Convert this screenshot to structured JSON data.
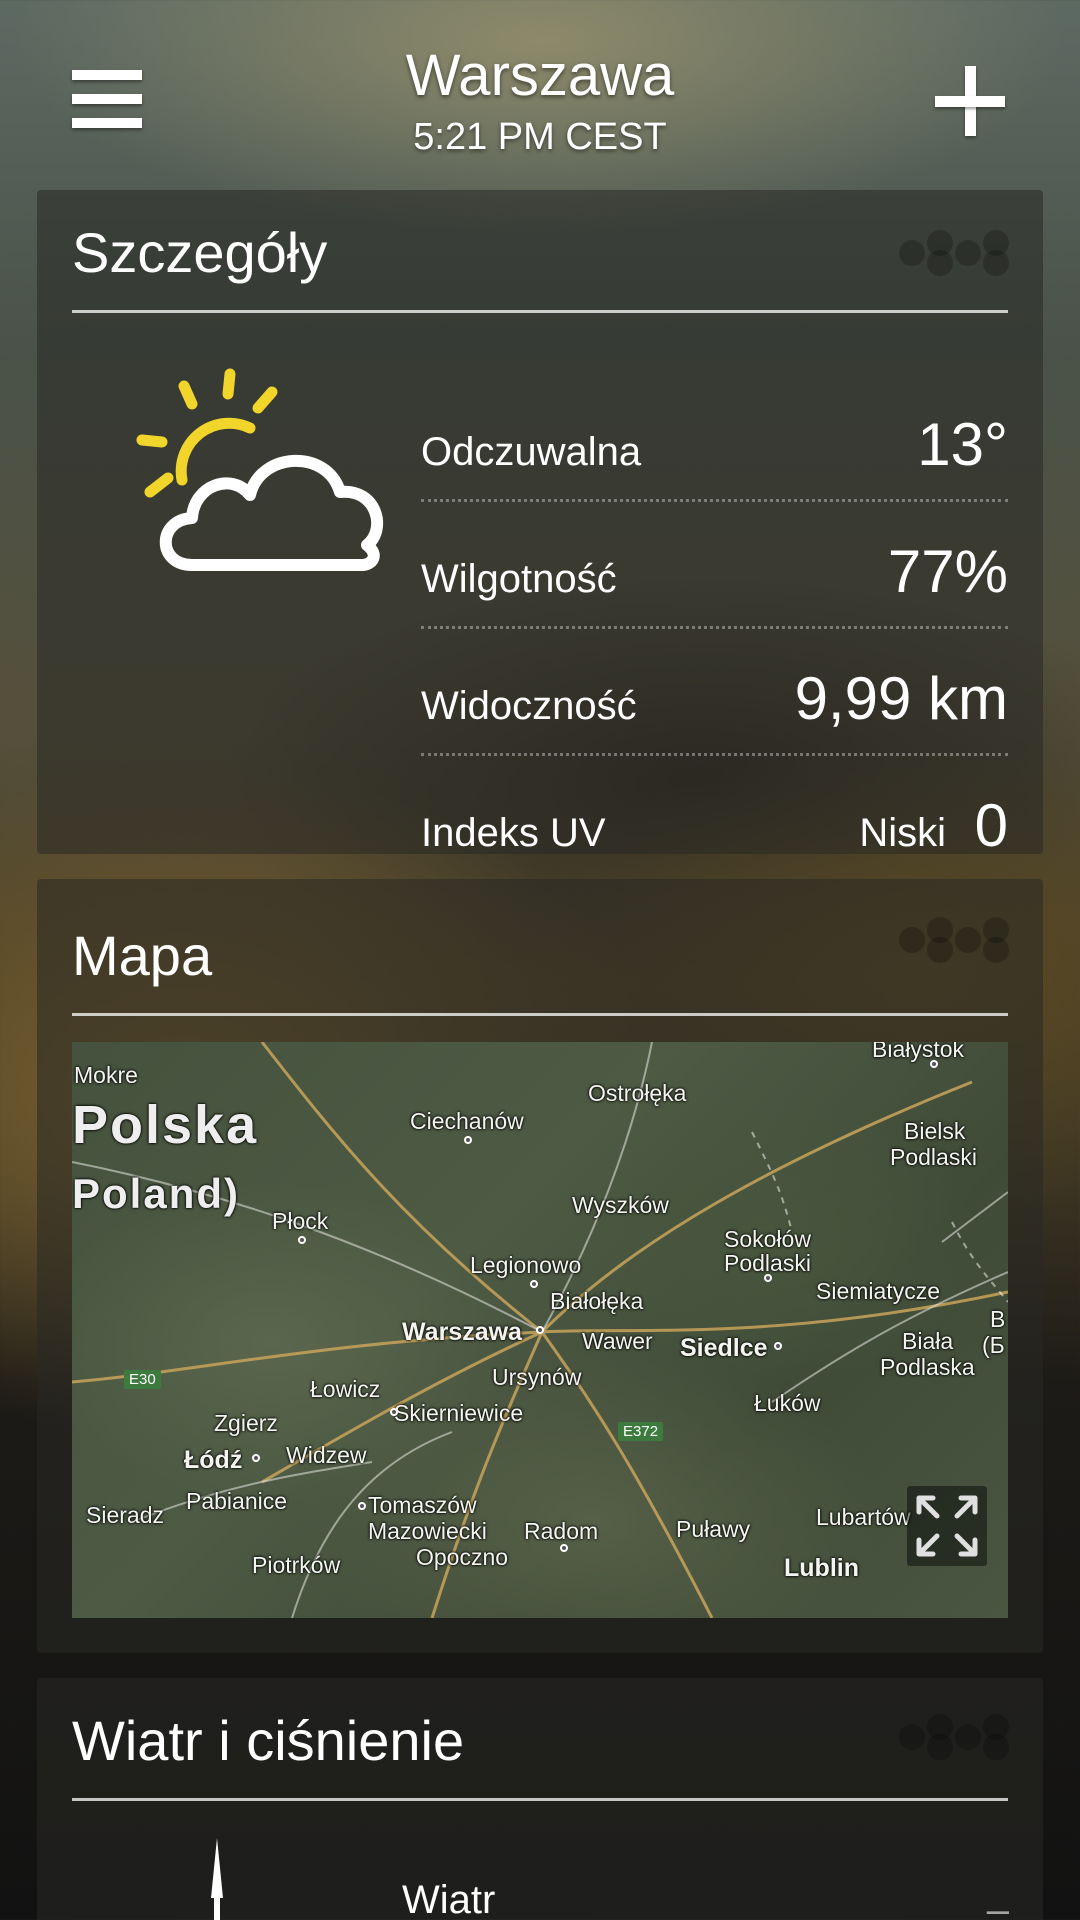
{
  "header": {
    "city": "Warszawa",
    "time": "5:21 PM CEST"
  },
  "details": {
    "title": "Szczegóły",
    "icon": "partly-cloudy-icon",
    "rows": [
      {
        "label": "Odczuwalna",
        "value": "13°"
      },
      {
        "label": "Wilgotność",
        "value": "77%"
      },
      {
        "label": "Widoczność",
        "value": "9,99 km"
      },
      {
        "label": "Indeks UV",
        "level": "Niski",
        "value": "0"
      }
    ]
  },
  "map": {
    "title": "Mapa",
    "country_line1": "Polska",
    "country_line2": "Poland)",
    "places": {
      "bialystok": "Białystok",
      "mokre": "Mokre",
      "ostroleka": "Ostrołęka",
      "ciechanow": "Ciechanów",
      "bielsk": "Bielsk",
      "podlaski": "Podlaski",
      "plock": "Płock",
      "wyszkow": "Wyszków",
      "sokolow": "Sokołów",
      "sokolow_podlaski": "Podlaski",
      "legionowo": "Legionowo",
      "bialoleka": "Białołęka",
      "siemiatycze": "Siemiatycze",
      "warszawa": "Warszawa",
      "wawer": "Wawer",
      "siedlce": "Siedlce",
      "biala": "Biała",
      "biala_podlaska": "Podlaska",
      "ursynow": "Ursynów",
      "lowicz": "Łowicz",
      "skierniewice": "Skierniewice",
      "lukow": "Łuków",
      "zgierz": "Zgierz",
      "lodz": "Łódź",
      "widzew": "Widzew",
      "pabianice": "Pabianice",
      "sieradz": "Sieradz",
      "tomaszow": "Tomaszów",
      "mazowiecki": "Mazowiecki",
      "radom": "Radom",
      "pulawy": "Puławy",
      "lubartow": "Lubartów",
      "opoczno": "Opoczno",
      "piotrkow": "Piotrków",
      "lublin": "Lublin",
      "edge_b": "B",
      "edge_b2": "(Б"
    },
    "roads": {
      "e30": "E30",
      "e372": "E372"
    }
  },
  "wind": {
    "title": "Wiatr i ciśnienie",
    "label": "Wiatr",
    "value": "–"
  }
}
